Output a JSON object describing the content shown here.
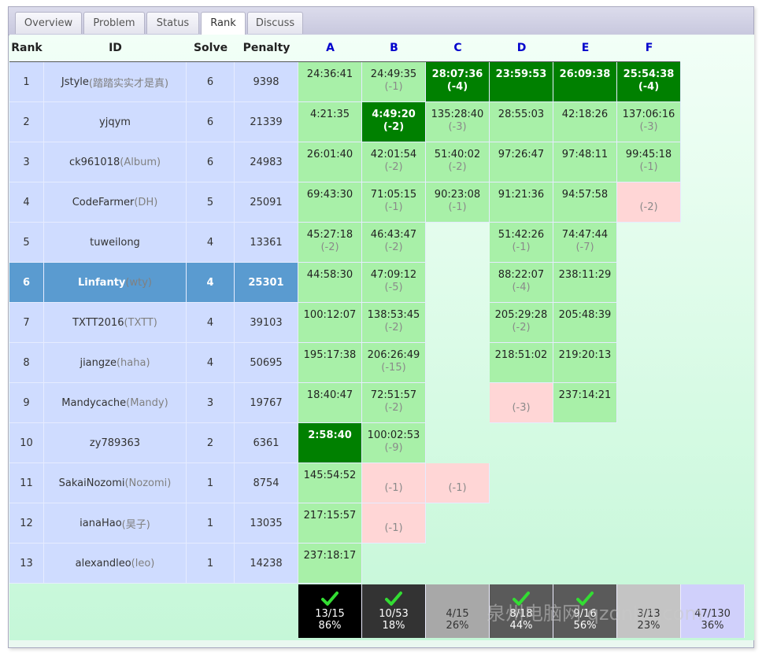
{
  "tabs": [
    "Overview",
    "Problem",
    "Status",
    "Rank",
    "Discuss"
  ],
  "active_tab": "Rank",
  "headers": {
    "rank": "Rank",
    "id": "ID",
    "solve": "Solve",
    "penalty": "Penalty"
  },
  "problems": [
    "A",
    "B",
    "C",
    "D",
    "E",
    "F"
  ],
  "rows": [
    {
      "rank": "1",
      "user": "Jstyle",
      "nick": "(踏踏实实才是真)",
      "solve": "6",
      "penalty": "9398",
      "selected": false,
      "cells": [
        {
          "t": "24:36:41",
          "p": "",
          "s": "ac"
        },
        {
          "t": "24:49:35",
          "p": "(-1)",
          "s": "ac"
        },
        {
          "t": "28:07:36",
          "p": "(-4)",
          "s": "fb"
        },
        {
          "t": "23:59:53",
          "p": "",
          "s": "fb"
        },
        {
          "t": "26:09:38",
          "p": "",
          "s": "fb"
        },
        {
          "t": "25:54:38",
          "p": "(-4)",
          "s": "fb"
        }
      ]
    },
    {
      "rank": "2",
      "user": "yjqym",
      "nick": "",
      "solve": "6",
      "penalty": "21339",
      "selected": false,
      "cells": [
        {
          "t": "4:21:35",
          "p": "",
          "s": "ac"
        },
        {
          "t": "4:49:20",
          "p": "(-2)",
          "s": "fb"
        },
        {
          "t": "135:28:40",
          "p": "(-3)",
          "s": "ac"
        },
        {
          "t": "28:55:03",
          "p": "",
          "s": "ac"
        },
        {
          "t": "42:18:26",
          "p": "",
          "s": "ac"
        },
        {
          "t": "137:06:16",
          "p": "(-3)",
          "s": "ac"
        }
      ]
    },
    {
      "rank": "3",
      "user": "ck961018",
      "nick": "(Album)",
      "solve": "6",
      "penalty": "24983",
      "selected": false,
      "cells": [
        {
          "t": "26:01:40",
          "p": "",
          "s": "ac"
        },
        {
          "t": "42:01:54",
          "p": "(-2)",
          "s": "ac"
        },
        {
          "t": "51:40:02",
          "p": "(-2)",
          "s": "ac"
        },
        {
          "t": "97:26:47",
          "p": "",
          "s": "ac"
        },
        {
          "t": "97:48:11",
          "p": "",
          "s": "ac"
        },
        {
          "t": "99:45:18",
          "p": "(-1)",
          "s": "ac"
        }
      ]
    },
    {
      "rank": "4",
      "user": "CodeFarmer",
      "nick": "(DH)",
      "solve": "5",
      "penalty": "25091",
      "selected": false,
      "cells": [
        {
          "t": "69:43:30",
          "p": "",
          "s": "ac"
        },
        {
          "t": "71:05:15",
          "p": "(-1)",
          "s": "ac"
        },
        {
          "t": "90:23:08",
          "p": "(-1)",
          "s": "ac"
        },
        {
          "t": "91:21:36",
          "p": "",
          "s": "ac"
        },
        {
          "t": "94:57:58",
          "p": "",
          "s": "ac"
        },
        {
          "t": "",
          "p": "(-2)",
          "s": "wa"
        }
      ]
    },
    {
      "rank": "5",
      "user": "tuweilong",
      "nick": "",
      "solve": "4",
      "penalty": "13361",
      "selected": false,
      "cells": [
        {
          "t": "45:27:18",
          "p": "(-2)",
          "s": "ac"
        },
        {
          "t": "46:43:47",
          "p": "(-2)",
          "s": "ac"
        },
        null,
        {
          "t": "51:42:26",
          "p": "(-1)",
          "s": "ac"
        },
        {
          "t": "74:47:44",
          "p": "(-7)",
          "s": "ac"
        },
        null
      ]
    },
    {
      "rank": "6",
      "user": "Linfanty",
      "nick": "(wty)",
      "solve": "4",
      "penalty": "25301",
      "selected": true,
      "cells": [
        {
          "t": "44:58:30",
          "p": "",
          "s": "ac"
        },
        {
          "t": "47:09:12",
          "p": "(-5)",
          "s": "ac"
        },
        null,
        {
          "t": "88:22:07",
          "p": "(-4)",
          "s": "ac"
        },
        {
          "t": "238:11:29",
          "p": "",
          "s": "ac"
        },
        null
      ]
    },
    {
      "rank": "7",
      "user": "TXTT2016",
      "nick": "(TXTT)",
      "solve": "4",
      "penalty": "39103",
      "selected": false,
      "cells": [
        {
          "t": "100:12:07",
          "p": "",
          "s": "ac"
        },
        {
          "t": "138:53:45",
          "p": "(-2)",
          "s": "ac"
        },
        null,
        {
          "t": "205:29:28",
          "p": "(-2)",
          "s": "ac"
        },
        {
          "t": "205:48:39",
          "p": "",
          "s": "ac"
        },
        null
      ]
    },
    {
      "rank": "8",
      "user": "jiangze",
      "nick": "(haha)",
      "solve": "4",
      "penalty": "50695",
      "selected": false,
      "cells": [
        {
          "t": "195:17:38",
          "p": "",
          "s": "ac"
        },
        {
          "t": "206:26:49",
          "p": "(-15)",
          "s": "ac"
        },
        null,
        {
          "t": "218:51:02",
          "p": "",
          "s": "ac"
        },
        {
          "t": "219:20:13",
          "p": "",
          "s": "ac"
        },
        null
      ]
    },
    {
      "rank": "9",
      "user": "Mandycache",
      "nick": "(Mandy)",
      "solve": "3",
      "penalty": "19767",
      "selected": false,
      "cells": [
        {
          "t": "18:40:47",
          "p": "",
          "s": "ac"
        },
        {
          "t": "72:51:57",
          "p": "(-2)",
          "s": "ac"
        },
        null,
        {
          "t": "",
          "p": "(-3)",
          "s": "wa"
        },
        {
          "t": "237:14:21",
          "p": "",
          "s": "ac"
        },
        null
      ]
    },
    {
      "rank": "10",
      "user": "zy789363",
      "nick": "",
      "solve": "2",
      "penalty": "6361",
      "selected": false,
      "cells": [
        {
          "t": "2:58:40",
          "p": "",
          "s": "fb"
        },
        {
          "t": "100:02:53",
          "p": "(-9)",
          "s": "ac"
        },
        null,
        null,
        null,
        null
      ]
    },
    {
      "rank": "11",
      "user": "SakaiNozomi",
      "nick": "(Nozomi)",
      "solve": "1",
      "penalty": "8754",
      "selected": false,
      "cells": [
        {
          "t": "145:54:52",
          "p": "",
          "s": "ac"
        },
        {
          "t": "",
          "p": "(-1)",
          "s": "wa"
        },
        {
          "t": "",
          "p": "(-1)",
          "s": "wa"
        },
        null,
        null,
        null
      ]
    },
    {
      "rank": "12",
      "user": "ianaHao",
      "nick": "(昊子)",
      "solve": "1",
      "penalty": "13035",
      "selected": false,
      "cells": [
        {
          "t": "217:15:57",
          "p": "",
          "s": "ac"
        },
        {
          "t": "",
          "p": "(-1)",
          "s": "wa"
        },
        null,
        null,
        null,
        null
      ]
    },
    {
      "rank": "13",
      "user": "alexandleo",
      "nick": "(leo)",
      "solve": "1",
      "penalty": "14238",
      "selected": false,
      "cells": [
        {
          "t": "237:18:17",
          "p": "",
          "s": "ac"
        },
        null,
        null,
        null,
        null,
        null
      ]
    }
  ],
  "stats": [
    {
      "count": "13/15",
      "percent": "86%",
      "check": true,
      "bg": "#000000",
      "fg": "#ffffff"
    },
    {
      "count": "10/53",
      "percent": "18%",
      "check": true,
      "bg": "#333333",
      "fg": "#ffffff"
    },
    {
      "count": "4/15",
      "percent": "26%",
      "check": false,
      "bg": "#a8a8a8",
      "fg": "#333333"
    },
    {
      "count": "8/18",
      "percent": "44%",
      "check": true,
      "bg": "#5a5a5a",
      "fg": "#ffffff"
    },
    {
      "count": "9/16",
      "percent": "56%",
      "check": true,
      "bg": "#5a5a5a",
      "fg": "#ffffff"
    },
    {
      "count": "3/13",
      "percent": "23%",
      "check": false,
      "bg": "#c4c4c4",
      "fg": "#333333"
    },
    {
      "count": "47/130",
      "percent": "36%",
      "check": false,
      "bg": "#d0d0fb",
      "fg": "#333333"
    }
  ],
  "watermark": "泉州电脑网 qzdnba.com"
}
